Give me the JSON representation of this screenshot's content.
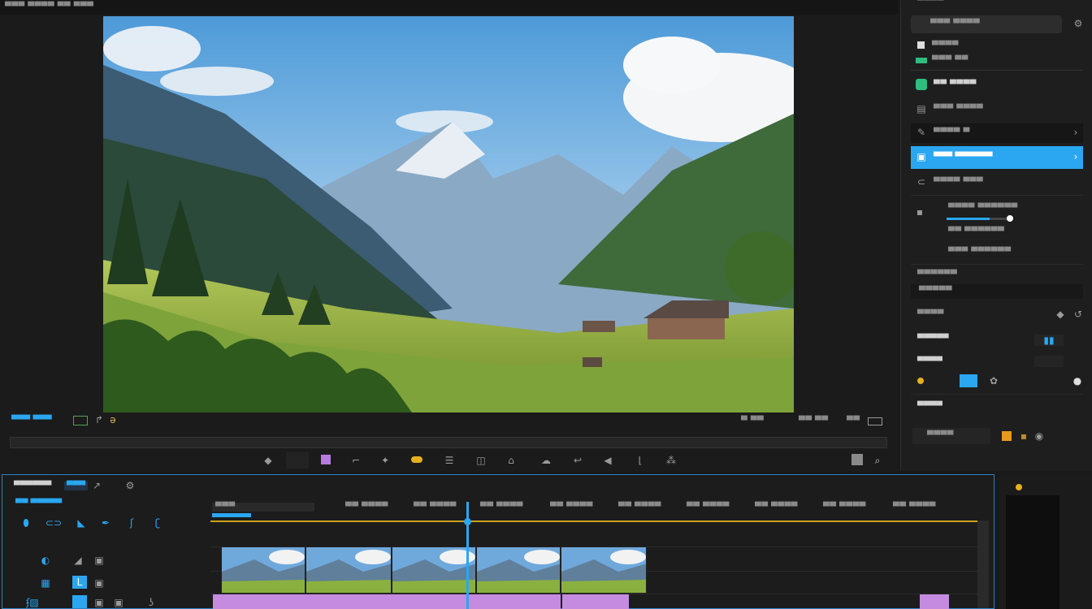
{
  "app": {
    "title": "▀▀▀ ▀▀▀▀ ▀▀ ▀▀▀"
  },
  "viewer": {
    "timecode": "▀▀▀ ▀▀▀",
    "right_labels": [
      "▀ ▀▀",
      "▀▀ ▀▀",
      "▀▀"
    ],
    "toolbar_icons": [
      "diamond-icon",
      "box-icon",
      "crop-icon",
      "wand-icon",
      "color-icon",
      "list-icon",
      "split-icon",
      "scan-icon",
      "cloud-icon",
      "arrow-icon",
      "speaker-icon",
      "corner-icon",
      "mask-icon",
      "fit-icon",
      "search-icon"
    ]
  },
  "right_panel": {
    "header": "▀▀▀▀",
    "search_placeholder": "▀▀▀ ▀▀▀▀",
    "row1": "▀▀▀▀",
    "row2": "▀▀▀ ▀▀",
    "items": [
      {
        "label": "▀▀ ▀▀▀▀",
        "highlight": false
      },
      {
        "label": "▀▀▀ ▀▀▀▀",
        "highlight": false
      },
      {
        "label": "▀▀▀▀ ▀",
        "highlight": false
      },
      {
        "label": "▀▀▀ ▀▀▀▀▀▀",
        "highlight": true
      },
      {
        "label": "▀▀▀▀ ▀▀▀",
        "highlight": false
      }
    ],
    "sub_items": [
      "▀▀▀▀ ▀▀▀▀▀▀",
      "▀▀ ▀▀▀▀▀▀",
      "▀▀▀ ▀▀▀▀▀▀"
    ],
    "slider_value": 0.68,
    "section1": "▀▀▀▀▀▀",
    "section1_sub": "▀▀▀▀▀",
    "section2": "▀▀▀▀",
    "section3": "▀▀▀▀▀",
    "section4": "▀▀▀▀",
    "section5": "▀▀▀▀",
    "bottom_select": "▀▀▀▀",
    "accent": "#2aa7f0"
  },
  "timeline": {
    "title": "▀▀▀▀▀▀",
    "tab": "▀▀▀",
    "subtitle": "▀▀ ▀▀▀▀▀",
    "ruler_labels": [
      "▀▀▀",
      "▀▀ ▀▀▀▀",
      "▀▀ ▀▀▀▀",
      "▀▀ ▀▀▀▀",
      "▀▀ ▀▀▀▀",
      "▀▀ ▀▀▀▀",
      "▀▀ ▀▀▀▀",
      "▀▀ ▀▀▀▀",
      "▀▀ ▀▀▀▀",
      "▀▀ ▀▀▀▀",
      "▀▀ ▀▀▀"
    ],
    "track_clip_color": "#c58be0",
    "playhead_color": "#2aa7f0"
  }
}
